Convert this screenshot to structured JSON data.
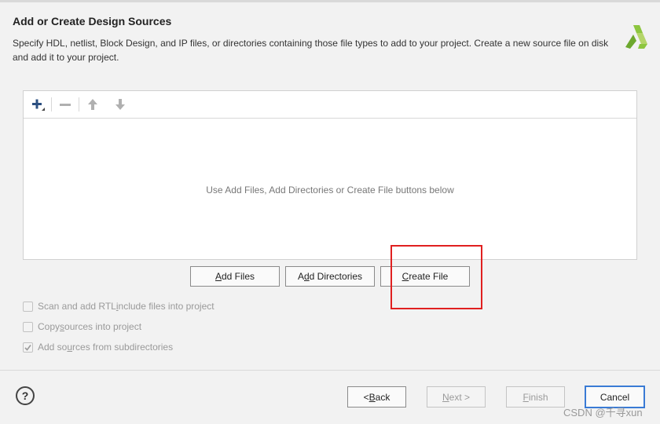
{
  "dialog": {
    "title": "Add or Create Design Sources",
    "description": "Specify HDL, netlist, Block Design, and IP files, or directories containing those file types to add to your project. Create a new source file on disk and add it to your project.",
    "logo_color": "#8dc63f"
  },
  "toolbar": {
    "icons": [
      "add-icon",
      "remove-icon",
      "move-up-icon",
      "move-down-icon"
    ]
  },
  "file_list": {
    "empty_message": "Use Add Files, Add Directories or Create File buttons below"
  },
  "actions": {
    "add_files": {
      "pre": "",
      "mnemonic": "A",
      "post": "dd Files"
    },
    "add_directories": {
      "pre": "A",
      "mnemonic": "d",
      "post": "d Directories"
    },
    "create_file": {
      "pre": "",
      "mnemonic": "C",
      "post": "reate File"
    }
  },
  "options": [
    {
      "pre": "Scan and add RTL ",
      "mnemonic": "i",
      "post": "nclude files into project",
      "checked": false
    },
    {
      "pre": "Copy ",
      "mnemonic": "s",
      "post": "ources into project",
      "checked": false
    },
    {
      "pre": "Add so",
      "mnemonic": "u",
      "post": "rces from subdirectories",
      "checked": true
    }
  ],
  "footer": {
    "help": "?",
    "back": {
      "pre": "< ",
      "mnemonic": "B",
      "post": "ack"
    },
    "next": {
      "pre": "",
      "mnemonic": "N",
      "post": "ext >"
    },
    "finish": {
      "pre": "",
      "mnemonic": "F",
      "post": "inish"
    },
    "cancel": "Cancel"
  },
  "watermark": "CSDN @千寻xun",
  "highlight_color": "#e02020"
}
